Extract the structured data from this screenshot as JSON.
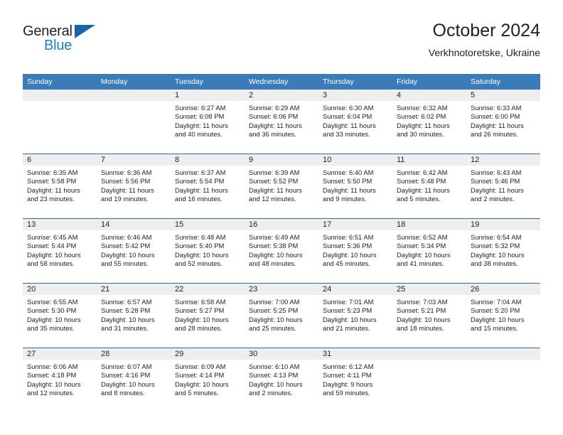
{
  "brand": {
    "name_part1": "General",
    "name_part2": "Blue",
    "accent_color": "#1b7fc4",
    "triangle_color": "#1565a8"
  },
  "header": {
    "title": "October 2024",
    "subtitle": "Verkhnotoretske, Ukraine"
  },
  "theme": {
    "header_blue": "#3b7cb8",
    "row_rule_blue": "#2b6ca8",
    "daynum_bg": "#eeeeee"
  },
  "weekday_headers": [
    "Sunday",
    "Monday",
    "Tuesday",
    "Wednesday",
    "Thursday",
    "Friday",
    "Saturday"
  ],
  "weeks": [
    [
      {
        "day": "",
        "lines": []
      },
      {
        "day": "",
        "lines": []
      },
      {
        "day": "1",
        "lines": [
          "Sunrise: 6:27 AM",
          "Sunset: 6:08 PM",
          "Daylight: 11 hours",
          "and 40 minutes."
        ]
      },
      {
        "day": "2",
        "lines": [
          "Sunrise: 6:29 AM",
          "Sunset: 6:06 PM",
          "Daylight: 11 hours",
          "and 36 minutes."
        ]
      },
      {
        "day": "3",
        "lines": [
          "Sunrise: 6:30 AM",
          "Sunset: 6:04 PM",
          "Daylight: 11 hours",
          "and 33 minutes."
        ]
      },
      {
        "day": "4",
        "lines": [
          "Sunrise: 6:32 AM",
          "Sunset: 6:02 PM",
          "Daylight: 11 hours",
          "and 30 minutes."
        ]
      },
      {
        "day": "5",
        "lines": [
          "Sunrise: 6:33 AM",
          "Sunset: 6:00 PM",
          "Daylight: 11 hours",
          "and 26 minutes."
        ]
      }
    ],
    [
      {
        "day": "6",
        "lines": [
          "Sunrise: 6:35 AM",
          "Sunset: 5:58 PM",
          "Daylight: 11 hours",
          "and 23 minutes."
        ]
      },
      {
        "day": "7",
        "lines": [
          "Sunrise: 6:36 AM",
          "Sunset: 5:56 PM",
          "Daylight: 11 hours",
          "and 19 minutes."
        ]
      },
      {
        "day": "8",
        "lines": [
          "Sunrise: 6:37 AM",
          "Sunset: 5:54 PM",
          "Daylight: 11 hours",
          "and 16 minutes."
        ]
      },
      {
        "day": "9",
        "lines": [
          "Sunrise: 6:39 AM",
          "Sunset: 5:52 PM",
          "Daylight: 11 hours",
          "and 12 minutes."
        ]
      },
      {
        "day": "10",
        "lines": [
          "Sunrise: 6:40 AM",
          "Sunset: 5:50 PM",
          "Daylight: 11 hours",
          "and 9 minutes."
        ]
      },
      {
        "day": "11",
        "lines": [
          "Sunrise: 6:42 AM",
          "Sunset: 5:48 PM",
          "Daylight: 11 hours",
          "and 5 minutes."
        ]
      },
      {
        "day": "12",
        "lines": [
          "Sunrise: 6:43 AM",
          "Sunset: 5:46 PM",
          "Daylight: 11 hours",
          "and 2 minutes."
        ]
      }
    ],
    [
      {
        "day": "13",
        "lines": [
          "Sunrise: 6:45 AM",
          "Sunset: 5:44 PM",
          "Daylight: 10 hours",
          "and 58 minutes."
        ]
      },
      {
        "day": "14",
        "lines": [
          "Sunrise: 6:46 AM",
          "Sunset: 5:42 PM",
          "Daylight: 10 hours",
          "and 55 minutes."
        ]
      },
      {
        "day": "15",
        "lines": [
          "Sunrise: 6:48 AM",
          "Sunset: 5:40 PM",
          "Daylight: 10 hours",
          "and 52 minutes."
        ]
      },
      {
        "day": "16",
        "lines": [
          "Sunrise: 6:49 AM",
          "Sunset: 5:38 PM",
          "Daylight: 10 hours",
          "and 48 minutes."
        ]
      },
      {
        "day": "17",
        "lines": [
          "Sunrise: 6:51 AM",
          "Sunset: 5:36 PM",
          "Daylight: 10 hours",
          "and 45 minutes."
        ]
      },
      {
        "day": "18",
        "lines": [
          "Sunrise: 6:52 AM",
          "Sunset: 5:34 PM",
          "Daylight: 10 hours",
          "and 41 minutes."
        ]
      },
      {
        "day": "19",
        "lines": [
          "Sunrise: 6:54 AM",
          "Sunset: 5:32 PM",
          "Daylight: 10 hours",
          "and 38 minutes."
        ]
      }
    ],
    [
      {
        "day": "20",
        "lines": [
          "Sunrise: 6:55 AM",
          "Sunset: 5:30 PM",
          "Daylight: 10 hours",
          "and 35 minutes."
        ]
      },
      {
        "day": "21",
        "lines": [
          "Sunrise: 6:57 AM",
          "Sunset: 5:28 PM",
          "Daylight: 10 hours",
          "and 31 minutes."
        ]
      },
      {
        "day": "22",
        "lines": [
          "Sunrise: 6:58 AM",
          "Sunset: 5:27 PM",
          "Daylight: 10 hours",
          "and 28 minutes."
        ]
      },
      {
        "day": "23",
        "lines": [
          "Sunrise: 7:00 AM",
          "Sunset: 5:25 PM",
          "Daylight: 10 hours",
          "and 25 minutes."
        ]
      },
      {
        "day": "24",
        "lines": [
          "Sunrise: 7:01 AM",
          "Sunset: 5:23 PM",
          "Daylight: 10 hours",
          "and 21 minutes."
        ]
      },
      {
        "day": "25",
        "lines": [
          "Sunrise: 7:03 AM",
          "Sunset: 5:21 PM",
          "Daylight: 10 hours",
          "and 18 minutes."
        ]
      },
      {
        "day": "26",
        "lines": [
          "Sunrise: 7:04 AM",
          "Sunset: 5:20 PM",
          "Daylight: 10 hours",
          "and 15 minutes."
        ]
      }
    ],
    [
      {
        "day": "27",
        "lines": [
          "Sunrise: 6:06 AM",
          "Sunset: 4:18 PM",
          "Daylight: 10 hours",
          "and 12 minutes."
        ]
      },
      {
        "day": "28",
        "lines": [
          "Sunrise: 6:07 AM",
          "Sunset: 4:16 PM",
          "Daylight: 10 hours",
          "and 8 minutes."
        ]
      },
      {
        "day": "29",
        "lines": [
          "Sunrise: 6:09 AM",
          "Sunset: 4:14 PM",
          "Daylight: 10 hours",
          "and 5 minutes."
        ]
      },
      {
        "day": "30",
        "lines": [
          "Sunrise: 6:10 AM",
          "Sunset: 4:13 PM",
          "Daylight: 10 hours",
          "and 2 minutes."
        ]
      },
      {
        "day": "31",
        "lines": [
          "Sunrise: 6:12 AM",
          "Sunset: 4:11 PM",
          "Daylight: 9 hours",
          "and 59 minutes."
        ]
      },
      {
        "day": "",
        "lines": []
      },
      {
        "day": "",
        "lines": []
      }
    ]
  ]
}
